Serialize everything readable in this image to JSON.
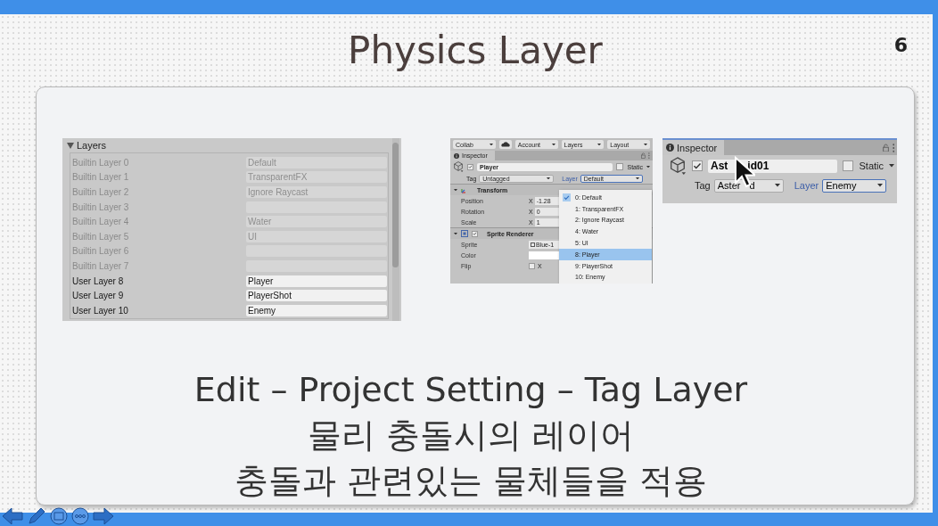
{
  "slide": {
    "title": "Physics Layer",
    "page_number": "6"
  },
  "layers_panel": {
    "header": "Layers",
    "expanded": true,
    "rows": [
      {
        "label": "Builtin Layer 0",
        "value": "Default",
        "disabled": true
      },
      {
        "label": "Builtin Layer 1",
        "value": "TransparentFX",
        "disabled": true
      },
      {
        "label": "Builtin Layer 2",
        "value": "Ignore Raycast",
        "disabled": true
      },
      {
        "label": "Builtin Layer 3",
        "disabled": true
      },
      {
        "label": "Builtin Layer 4",
        "value": "Water",
        "disabled": true
      },
      {
        "label": "Builtin Layer 5",
        "value": "UI",
        "disabled": true
      },
      {
        "label": "Builtin Layer 6",
        "disabled": true
      },
      {
        "label": "Builtin Layer 7",
        "disabled": true
      },
      {
        "label": "User Layer 8",
        "value": "Player",
        "disabled": false
      },
      {
        "label": "User Layer 9",
        "value": "PlayerShot",
        "disabled": false
      },
      {
        "label": "User Layer 10",
        "value": "Enemy",
        "disabled": false
      }
    ]
  },
  "inspector_menu": {
    "toolbar": [
      "Collab",
      "Account",
      "Layers",
      "Layout"
    ],
    "tab": "Inspector",
    "object": {
      "active": true,
      "name": "Player",
      "static_label": "Static",
      "static": false,
      "tag_label": "Tag",
      "tag": "Untagged",
      "layer_label": "Layer",
      "layer": "Default"
    },
    "components": [
      {
        "title": "Transform",
        "kind": "transform",
        "fields": [
          {
            "kind": "vector",
            "label": "Position",
            "axis": "X",
            "value": "-1.28"
          },
          {
            "kind": "vector",
            "label": "Rotation",
            "axis": "X",
            "value": "0"
          },
          {
            "kind": "vector",
            "label": "Scale",
            "axis": "X",
            "value": "1"
          }
        ]
      },
      {
        "title": "Sprite Renderer",
        "kind": "renderer",
        "enabled": true,
        "fields": [
          {
            "kind": "object",
            "label": "Sprite",
            "value": "Blue-1"
          },
          {
            "kind": "color",
            "label": "Color"
          },
          {
            "kind": "toggle",
            "label": "Flip",
            "axis": "X",
            "checked": false
          }
        ]
      }
    ],
    "menu": [
      {
        "label": "0: Default",
        "checked": true,
        "selected": false
      },
      {
        "label": "1: TransparentFX",
        "checked": false,
        "selected": false
      },
      {
        "label": "2: Ignore Raycast",
        "checked": false,
        "selected": false
      },
      {
        "label": "4: Water",
        "checked": false,
        "selected": false
      },
      {
        "label": "5: UI",
        "checked": false,
        "selected": false
      },
      {
        "label": "8: Player",
        "checked": false,
        "selected": true
      },
      {
        "label": "9: PlayerShot",
        "checked": false,
        "selected": false
      },
      {
        "label": "10: Enemy",
        "checked": false,
        "selected": false
      }
    ]
  },
  "inspector": {
    "tab": "Inspector",
    "active": true,
    "name_parts": [
      "Ast",
      "id01"
    ],
    "static_label": "Static",
    "static": false,
    "tag_label": "Tag",
    "tag_parts": [
      "Aster",
      "d"
    ],
    "layer_label": "Layer",
    "layer": "Enemy"
  },
  "caption": [
    "Edit – Project Setting – Tag Layer",
    "물리 충돌시의 레이어",
    "충돌과 관련있는 물체들을 적용"
  ]
}
